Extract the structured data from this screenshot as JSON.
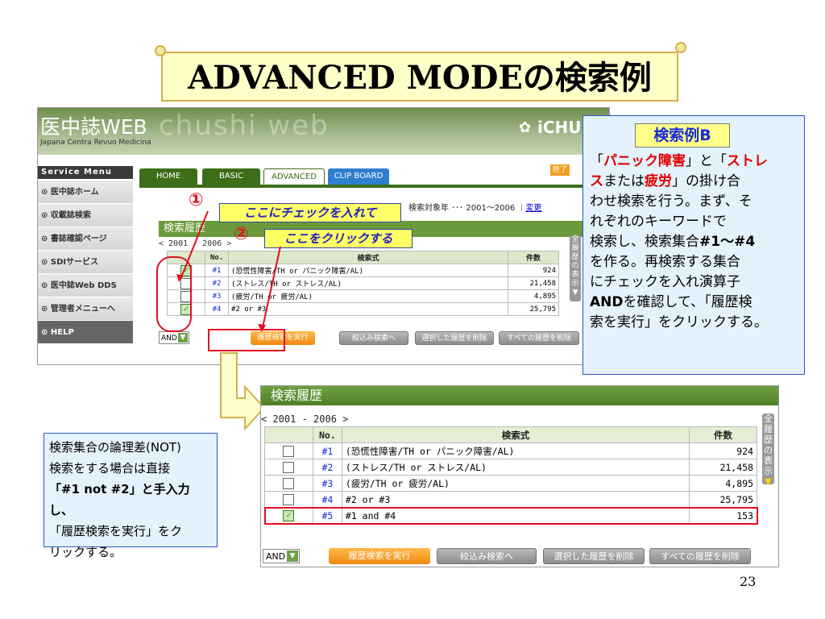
{
  "slide": {
    "title": "ADVANCED MODEの検索例",
    "page_number": "23"
  },
  "screen1": {
    "logo": "医中誌WEB",
    "logo_bg": "chushi web",
    "subtitle": "Japana Centra Revuo Medicina",
    "brand": "iCHUS",
    "menu_header": "Service Menu",
    "menu_items": [
      "医中誌ホーム",
      "収載誌検索",
      "書誌確認ページ",
      "SDIサービス",
      "医中誌Web DDS",
      "管理者メニューへ",
      "HELP"
    ],
    "tabs": [
      "HOME",
      "BASIC",
      "ADVANCED",
      "CLIP BOARD"
    ],
    "top_right_btn": "終了",
    "section_title": "検索履歴",
    "search_year_label": "検索対象年 ･･･ 2001～2006 ｜",
    "search_year_link": "変更",
    "range": "< 2001 - 2006 >",
    "headers": {
      "no": "No.",
      "query": "検索式",
      "count": "件数"
    },
    "rows": [
      {
        "checked": true,
        "no": "#1",
        "query": "(恐慌性障害/TH or パニック障害/AL)",
        "count": "924"
      },
      {
        "checked": false,
        "no": "#2",
        "query": "(ストレス/TH or ストレス/AL)",
        "count": "21,458"
      },
      {
        "checked": false,
        "no": "#3",
        "query": "(疲労/TH or 疲労/AL)",
        "count": "4,895"
      },
      {
        "checked": true,
        "no": "#4",
        "query": "#2 or #3",
        "count": "25,795"
      }
    ],
    "side_tab": "全履歴の表示",
    "operator": "AND",
    "buttons": [
      "履歴検索を実行",
      "絞込み検索へ",
      "選択した履歴を削除",
      "すべての履歴を削除"
    ]
  },
  "callouts": {
    "one_num": "①",
    "one_text": "ここにチェックを入れて",
    "two_num": "②",
    "two_text": "ここをクリックする"
  },
  "box_right": {
    "title": "検索例B",
    "lines": [
      {
        "p1": "「",
        "r1": "パニック障害",
        "p2": "」と「",
        "r2": "ストレ"
      },
      {
        "r1": "ス",
        "p1": "または",
        "r2": "疲労",
        "p2": "」の掛け合"
      },
      {
        "t": "わせ検索を行う。まず、そ"
      },
      {
        "t": "れぞれのキーワードで"
      },
      {
        "p1": "検索し、検索集合",
        "k": "#1～#4"
      },
      {
        "t": "を作る。再検索する集合"
      },
      {
        "t": "にチェックを入れ演算子"
      },
      {
        "k": "AND",
        "p1": "を確認して、「履歴検"
      },
      {
        "t": "索を実行」をクリックする。"
      }
    ]
  },
  "box_left": {
    "lines": [
      {
        "t": "検索集合の論理差(NOT)"
      },
      {
        "t": "検索をする場合は直接"
      },
      {
        "k": "「#1 not #2」と手入力し、"
      },
      {
        "t": "「履歴検索を実行」をク"
      },
      {
        "t": "リックする。"
      }
    ]
  },
  "screen2": {
    "section_title": "検索履歴",
    "range": "< 2001 - 2006 >",
    "headers": {
      "no": "No.",
      "query": "検索式",
      "count": "件数"
    },
    "rows": [
      {
        "checked": false,
        "no": "#1",
        "query": "(恐慌性障害/TH or パニック障害/AL)",
        "count": "924"
      },
      {
        "checked": false,
        "no": "#2",
        "query": "(ストレス/TH or ストレス/AL)",
        "count": "21,458"
      },
      {
        "checked": false,
        "no": "#3",
        "query": "(疲労/TH or 疲労/AL)",
        "count": "4,895"
      },
      {
        "checked": false,
        "no": "#4",
        "query": "#2 or #3",
        "count": "25,795"
      },
      {
        "checked": true,
        "no": "#5",
        "query": "#1 and #4",
        "count": "153"
      }
    ],
    "side_tab": "全履歴の表示",
    "operator": "AND",
    "buttons": [
      "履歴検索を実行",
      "絞込み検索へ",
      "選択した履歴を削除",
      "すべての履歴を削除"
    ]
  },
  "colors": {
    "accent_green": "#4f7f24",
    "callout_red": "#e01020",
    "highlight_yellow": "#ffff66",
    "box_blue_border": "#2a55c8",
    "box_fill": "#e4f2fb"
  }
}
